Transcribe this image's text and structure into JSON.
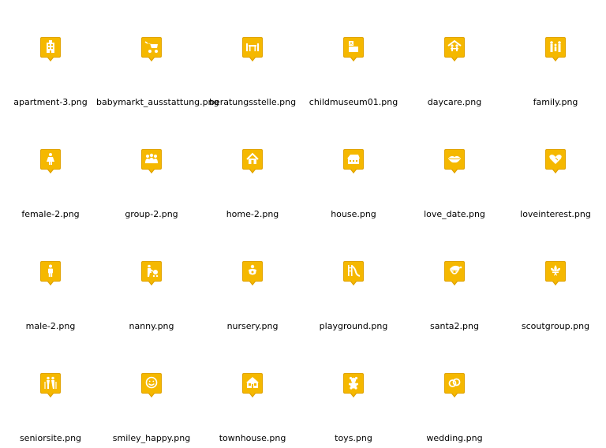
{
  "accent_color": "#f5b800",
  "icons": [
    {
      "filename": "apartment-3.png",
      "icon": "apartment-icon"
    },
    {
      "filename": "babymarkt_ausstattung.png",
      "icon": "baby-stroller-icon"
    },
    {
      "filename": "beratungsstelle.png",
      "icon": "counseling-table-icon"
    },
    {
      "filename": "childmuseum01.png",
      "icon": "toy-blocks-icon"
    },
    {
      "filename": "daycare.png",
      "icon": "daycare-icon"
    },
    {
      "filename": "family.png",
      "icon": "family-icon"
    },
    {
      "filename": "female-2.png",
      "icon": "female-icon"
    },
    {
      "filename": "group-2.png",
      "icon": "group-icon"
    },
    {
      "filename": "home-2.png",
      "icon": "home-icon"
    },
    {
      "filename": "house.png",
      "icon": "house-icon"
    },
    {
      "filename": "love_date.png",
      "icon": "lips-icon"
    },
    {
      "filename": "loveinterest.png",
      "icon": "hearts-icon"
    },
    {
      "filename": "male-2.png",
      "icon": "male-icon"
    },
    {
      "filename": "nanny.png",
      "icon": "nanny-icon"
    },
    {
      "filename": "nursery.png",
      "icon": "baby-icon"
    },
    {
      "filename": "playground.png",
      "icon": "slide-icon"
    },
    {
      "filename": "santa2.png",
      "icon": "santa-icon"
    },
    {
      "filename": "scoutgroup.png",
      "icon": "fleur-de-lis-icon"
    },
    {
      "filename": "seniorsite.png",
      "icon": "seniors-icon"
    },
    {
      "filename": "smiley_happy.png",
      "icon": "smiley-icon"
    },
    {
      "filename": "townhouse.png",
      "icon": "townhouse-icon"
    },
    {
      "filename": "toys.png",
      "icon": "teddy-bear-icon"
    },
    {
      "filename": "wedding.png",
      "icon": "wedding-rings-icon"
    }
  ]
}
